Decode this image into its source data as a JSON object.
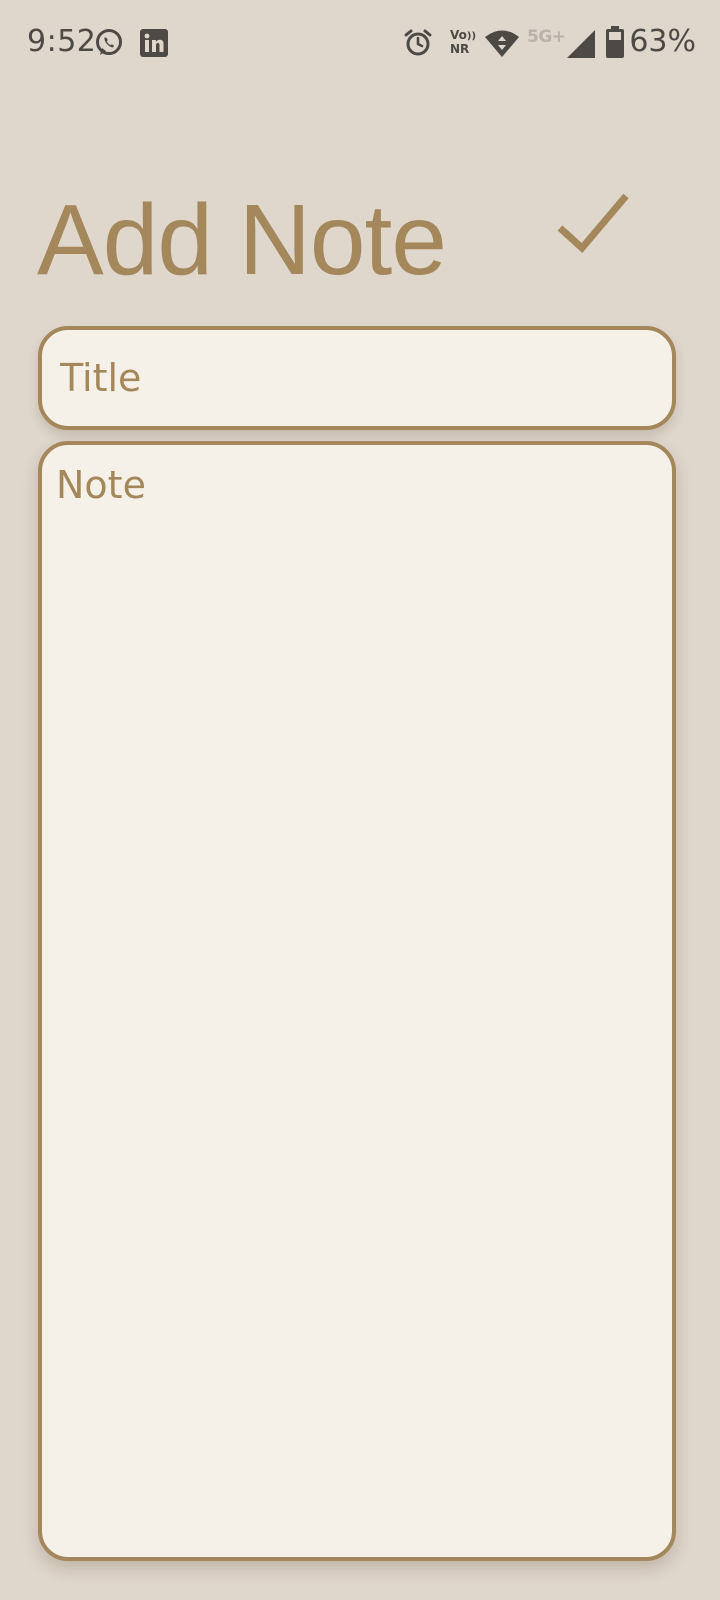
{
  "status_bar": {
    "time": "9:52",
    "vo_label": "Vo",
    "nr_label": "NR",
    "network_label": "5G+",
    "battery_percent": "63%",
    "icons": [
      "whatsapp-icon",
      "linkedin-icon",
      "alarm-icon",
      "vonr-icon",
      "wifi-icon",
      "signal-icon",
      "battery-icon"
    ]
  },
  "header": {
    "title": "Add Note",
    "save_icon": "check-icon"
  },
  "form": {
    "title_placeholder": "Title",
    "title_value": "",
    "note_placeholder": "Note",
    "note_value": ""
  },
  "colors": {
    "background": "#dfd6cc",
    "accent": "#a4875a",
    "field_background": "#f5f1e8",
    "status_text": "#4d4a46"
  }
}
